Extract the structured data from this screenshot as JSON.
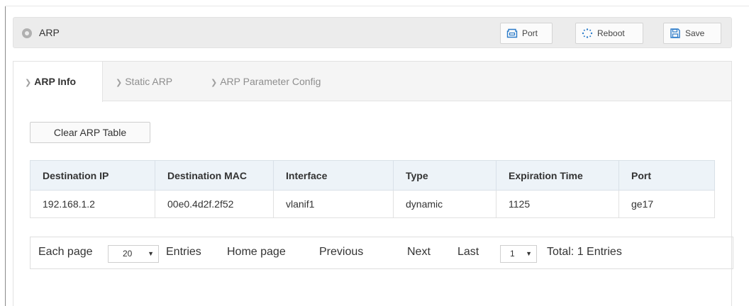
{
  "header": {
    "title": "ARP",
    "buttons": {
      "port": "Port",
      "reboot": "Reboot",
      "save": "Save"
    }
  },
  "tabs": [
    {
      "label": "ARP Info",
      "active": true
    },
    {
      "label": "Static ARP",
      "active": false
    },
    {
      "label": "ARP Parameter Config",
      "active": false
    }
  ],
  "actions": {
    "clear_arp_table": "Clear ARP Table"
  },
  "table": {
    "columns": [
      "Destination IP",
      "Destination MAC",
      "Interface",
      "Type",
      "Expiration Time",
      "Port"
    ],
    "rows": [
      [
        "192.168.1.2",
        "00e0.4d2f.2f52",
        "vlanif1",
        "dynamic",
        "1125",
        "ge17"
      ]
    ]
  },
  "pager": {
    "each_page": "Each page",
    "page_size": "20",
    "entries": "Entries",
    "home": "Home page",
    "previous": "Previous",
    "next": "Next",
    "last": "Last",
    "current_page": "1",
    "total": "Total: 1 Entries"
  },
  "colors": {
    "header_bg": "#ececec",
    "table_header_bg": "#edf3f8",
    "icon_blue": "#2b7bc9"
  },
  "icons": {
    "header": "location-dot-icon",
    "port": "port-icon",
    "reboot": "spinner-icon",
    "save": "floppy-disk-icon"
  }
}
